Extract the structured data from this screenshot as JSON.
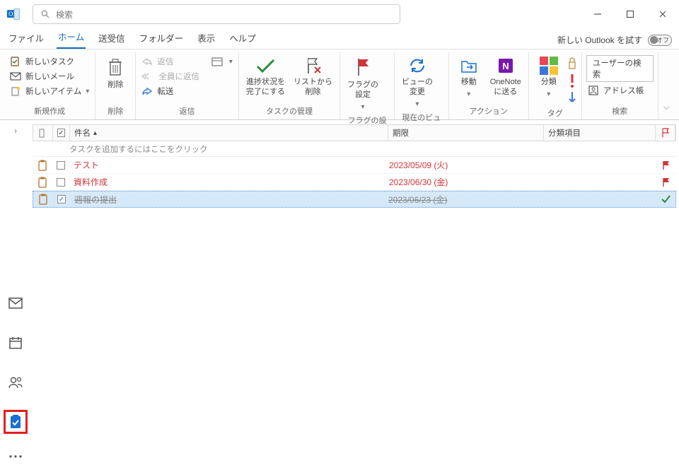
{
  "search": {
    "placeholder": "検索"
  },
  "menu": {
    "file": "ファイル",
    "home": "ホーム",
    "sendrecv": "送受信",
    "folder": "フォルダー",
    "view": "表示",
    "help": "ヘルプ",
    "try_new": "新しい Outlook を試す",
    "toggle_off": "オフ"
  },
  "ribbon": {
    "new_task": "新しいタスク",
    "new_mail": "新しいメール",
    "new_items": "新しいアイテム",
    "group_new": "新規作成",
    "delete": "削除",
    "group_delete": "削除",
    "reply": "返信",
    "reply_all": "全員に返信",
    "forward": "転送",
    "more_btn": "",
    "group_respond": "返信",
    "complete": "進捗状況を\n完了にする",
    "remove_list": "リストから\n削除",
    "group_manage": "タスクの管理",
    "flag_settings": "フラグの\n設定",
    "group_flags": "フラグの設定",
    "change_view": "ビューの\n変更",
    "group_view": "現在のビュー",
    "move": "移動",
    "onenote": "OneNote\nに送る",
    "group_actions": "アクション",
    "categorize": "分類",
    "group_tags": "タグ",
    "search_user": "ユーザーの検索",
    "address_book": "アドレス帳",
    "group_search": "検索"
  },
  "columns": {
    "subject": "件名",
    "due": "期限",
    "category": "分類項目"
  },
  "addrow": "タスクを追加するにはここをクリック",
  "tasks": [
    {
      "subject": "テスト",
      "due": "2023/05/09 (火)",
      "done": false,
      "overdue": true
    },
    {
      "subject": "資料作成",
      "due": "2023/06/30 (金)",
      "done": false,
      "overdue": true
    },
    {
      "subject": "週報の提出",
      "due": "2023/06/23 (金)",
      "done": true,
      "overdue": false
    }
  ]
}
